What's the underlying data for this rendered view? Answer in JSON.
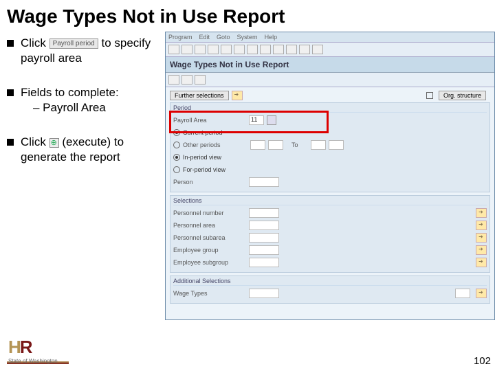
{
  "title": "Wage Types Not in Use Report",
  "bullets": {
    "b1_pre": "Click",
    "b1_btn": "Payroll period",
    "b1_post": "to specify payroll area",
    "b2": "Fields to complete:",
    "b2_sub": "– Payroll Area",
    "b3_pre": "Click",
    "b3_post": "(execute) to generate the report"
  },
  "sap": {
    "menu": [
      "Program",
      "Edit",
      "Goto",
      "System",
      "Help"
    ],
    "app_title": "Wage Types Not in Use Report",
    "further": "Further selections",
    "org": "Org. structure",
    "period": {
      "title": "Period",
      "payroll_area": "Payroll Area",
      "payroll_area_val": "11",
      "current": "Current period",
      "other": "Other periods",
      "inperiod": "In-period view",
      "forperiod": "For-period view",
      "to": "To",
      "person": "Person"
    },
    "selections": {
      "title": "Selections",
      "pernr": "Personnel number",
      "parea": "Personnel area",
      "psub": "Personnel subarea",
      "egrp": "Employee group",
      "esub": "Employee subgroup"
    },
    "additional": {
      "title": "Additional Selections",
      "wt": "Wage Types"
    }
  },
  "footer": {
    "state": "State of Washington",
    "page": "102"
  }
}
